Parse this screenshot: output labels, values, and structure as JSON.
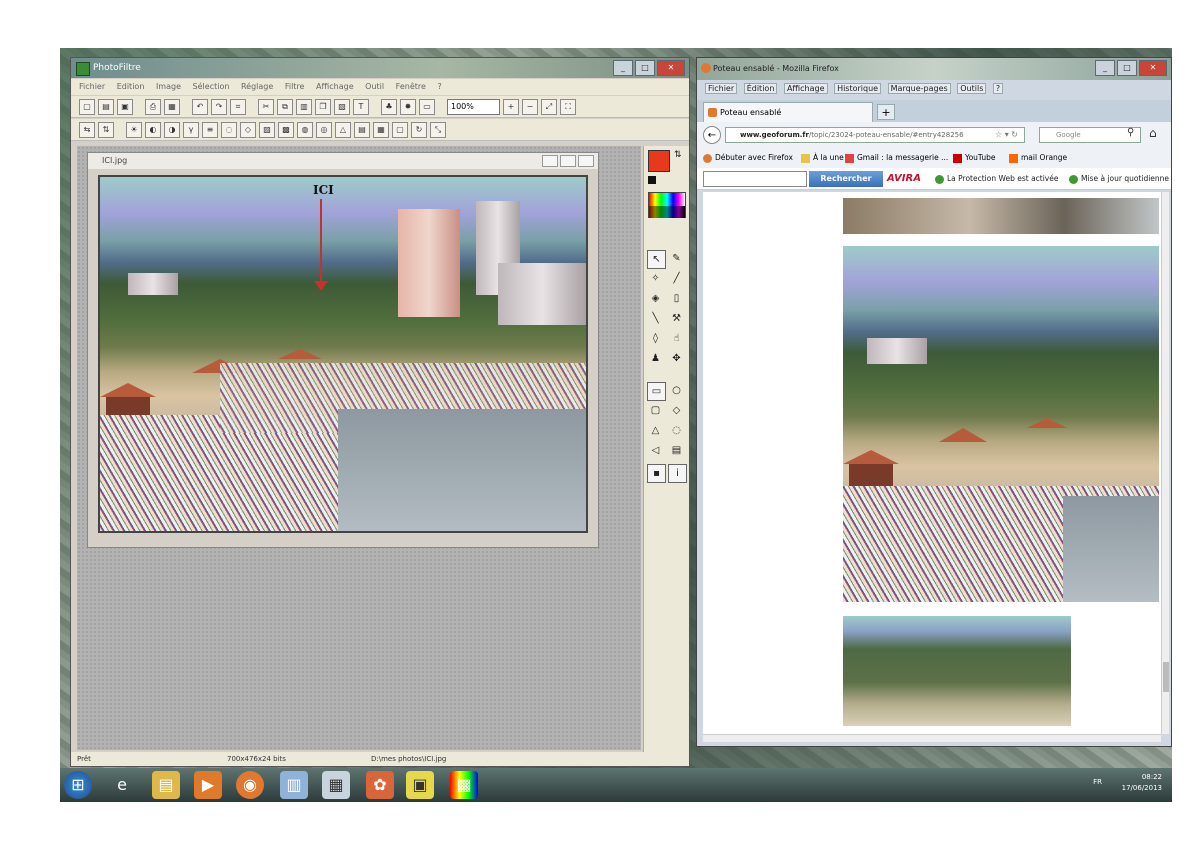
{
  "photofiltre": {
    "title": "PhotoFiltre",
    "menu": [
      "Fichier",
      "Edition",
      "Image",
      "Sélection",
      "Réglage",
      "Filtre",
      "Affichage",
      "Outil",
      "Fenêtre",
      "?"
    ],
    "zoom": "100%",
    "document": {
      "title": "ICI.jpg",
      "annotation": "ICI"
    },
    "status": {
      "state": "Prêt",
      "size": "700x476x24 bits",
      "path": "D:\\mes photos\\ICI.jpg"
    },
    "colors": {
      "foreground": "#e8391c",
      "background": "#111111"
    }
  },
  "firefox": {
    "title": "Poteau ensablé - Mozilla Firefox",
    "menu": [
      "Fichier",
      "Édition",
      "Affichage",
      "Historique",
      "Marque-pages",
      "Outils",
      "?"
    ],
    "tab": "Poteau ensablé",
    "url_domain": "www.geoforum.fr",
    "url_rest": "/topic/23024-poteau-ensable/#entry428256",
    "search_placeholder": "Google",
    "bookmarks": [
      "Débuter avec Firefox",
      "À la une",
      "Gmail : la messagerie ...",
      "YouTube",
      "mail Orange"
    ],
    "avira": {
      "search_button": "Rechercher",
      "brand": "AVIRA",
      "protection": "La Protection Web est activée",
      "updates": "Mise à jour quotidienne"
    }
  },
  "taskbar": {
    "lang": "FR",
    "time": "08:22",
    "date": "17/06/2013"
  }
}
